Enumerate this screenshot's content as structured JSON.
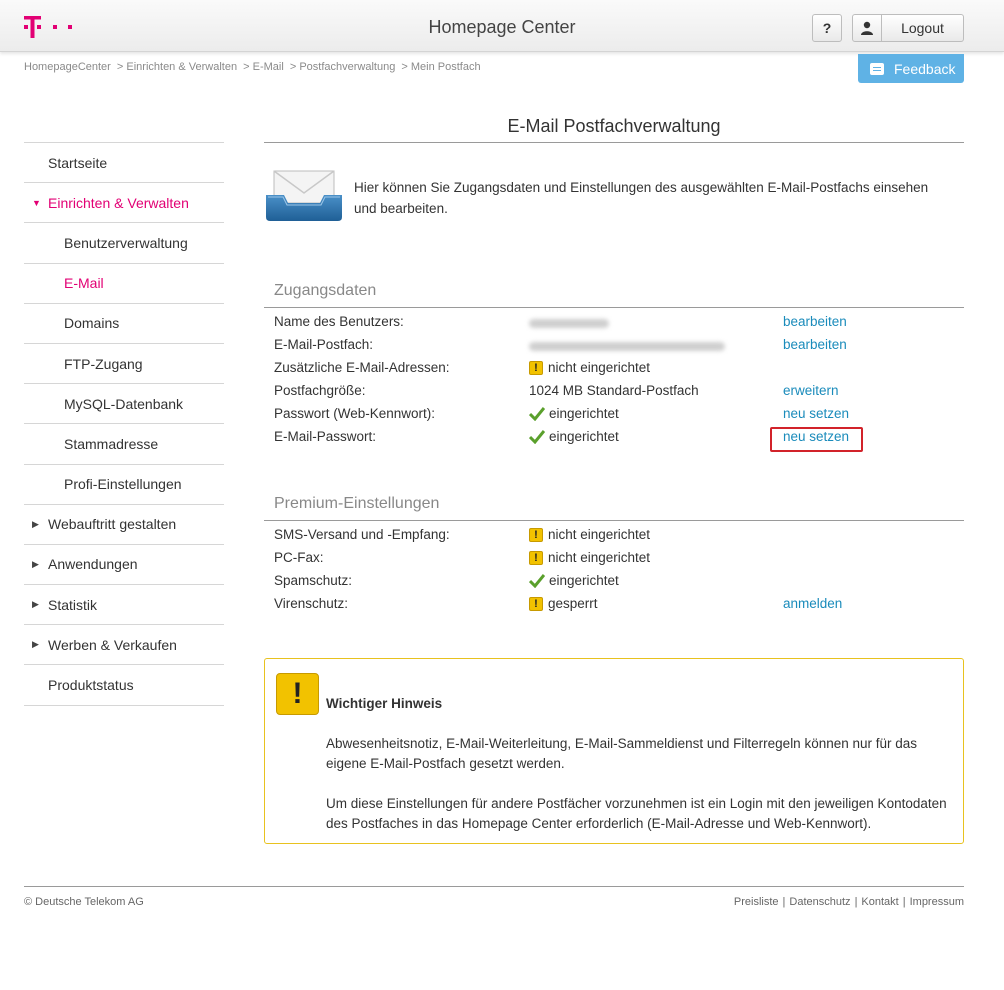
{
  "header": {
    "title": "Homepage Center",
    "help_label": "?",
    "logout_label": "Logout",
    "brand_color": "#e20074"
  },
  "breadcrumb": [
    "HomepageCenter",
    "> Einrichten & Verwalten",
    "> E-Mail",
    "> Postfachverwaltung",
    "> Mein Postfach"
  ],
  "feedback_label": "Feedback",
  "sidebar": {
    "items": [
      {
        "label": "Startseite",
        "level": 0
      },
      {
        "label": "Einrichten & Verwalten",
        "level": 0,
        "expanded": true,
        "active": true
      },
      {
        "label": "Benutzerverwaltung",
        "level": 1
      },
      {
        "label": "E-Mail",
        "level": 1,
        "active": true
      },
      {
        "label": "Domains",
        "level": 1
      },
      {
        "label": "FTP-Zugang",
        "level": 1
      },
      {
        "label": "MySQL-Datenbank",
        "level": 1
      },
      {
        "label": "Stammadresse",
        "level": 1
      },
      {
        "label": "Profi-Einstellungen",
        "level": 1
      },
      {
        "label": "Webauftritt gestalten",
        "level": 0,
        "collapsed": true
      },
      {
        "label": "Anwendungen",
        "level": 0,
        "collapsed": true
      },
      {
        "label": "Statistik",
        "level": 0,
        "collapsed": true
      },
      {
        "label": "Werben & Verkaufen",
        "level": 0,
        "collapsed": true
      },
      {
        "label": "Produktstatus",
        "level": 0
      }
    ]
  },
  "main": {
    "title": "E-Mail Postfachverwaltung",
    "intro": "Hier können Sie Zugangsdaten und Einstellungen des ausgewählten E-Mail-Postfachs einsehen und bearbeiten.",
    "zugangsdaten": {
      "title": "Zugangsdaten",
      "rows": [
        {
          "label": "Name des Benutzers:",
          "value": "",
          "blurred": true,
          "action": "bearbeiten"
        },
        {
          "label": "E-Mail-Postfach:",
          "value": "",
          "blurred": true,
          "action": "bearbeiten"
        },
        {
          "label": "Zusätzliche E-Mail-Adressen:",
          "value": "nicht eingerichtet",
          "icon": "warning-icon",
          "action": ""
        },
        {
          "label": "Postfachgröße:",
          "value": "1024 MB Standard-Postfach",
          "action": "erweitern"
        },
        {
          "label": "Passwort (Web-Kennwort):",
          "value": "eingerichtet",
          "icon": "check-icon",
          "action": "neu setzen"
        },
        {
          "label": "E-Mail-Passwort:",
          "value": "eingerichtet",
          "icon": "check-icon",
          "action": "neu setzen"
        }
      ]
    },
    "premium": {
      "title": "Premium-Einstellungen",
      "rows": [
        {
          "label": "SMS-Versand und -Empfang:",
          "value": "nicht eingerichtet",
          "icon": "warning-icon",
          "action": ""
        },
        {
          "label": "PC-Fax:",
          "value": "nicht eingerichtet",
          "icon": "warning-icon",
          "action": ""
        },
        {
          "label": "Spamschutz:",
          "value": "eingerichtet",
          "icon": "check-icon",
          "action": ""
        },
        {
          "label": "Virenschutz:",
          "value": "gesperrt",
          "icon": "warning-icon",
          "action": "anmelden"
        }
      ]
    },
    "notice": {
      "title": "Wichtiger Hinweis",
      "p1": "Abwesenheitsnotiz, E-Mail-Weiterleitung, E-Mail-Sammeldienst und Filterregeln können nur für das eigene E-Mail-Postfach gesetzt werden.",
      "p2": "Um diese Einstellungen für andere Postfächer vorzunehmen ist ein Login mit den jeweiligen Kontodaten des Postfaches in das Homepage Center erforderlich (E-Mail-Adresse und Web-Kennwort)."
    }
  },
  "footer": {
    "copyright": "© Deutsche Telekom AG",
    "links": [
      "Preisliste",
      "Datenschutz",
      "Kontakt",
      "Impressum"
    ]
  }
}
